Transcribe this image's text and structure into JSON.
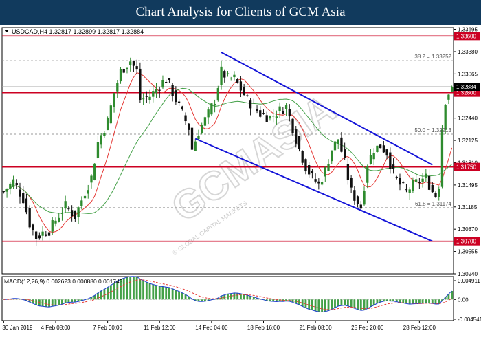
{
  "banner": {
    "title": "Chart Analysis for Clients of GCM Asia"
  },
  "chart_data": {
    "type": "candlestick",
    "symbol_header": "USDCAD,H4  1.32817 1.32899 1.32817 1.32884",
    "watermark": {
      "big": "GCMASIA",
      "small": "© GLOBAL CAPITAL MARKETS"
    },
    "price_axis": {
      "range": [
        1.3024,
        1.3372
      ],
      "ticks": [
        {
          "v": 1.33695,
          "label": "1.33695"
        },
        {
          "v": 1.3338,
          "label": "1.33380"
        },
        {
          "v": 1.33065,
          "label": "1.33065"
        },
        {
          "v": 1.3244,
          "label": "1.32440"
        },
        {
          "v": 1.32125,
          "label": "1.32125"
        },
        {
          "v": 1.3181,
          "label": "1.31810"
        },
        {
          "v": 1.31495,
          "label": "1.31495"
        },
        {
          "v": 1.31185,
          "label": "1.31185"
        },
        {
          "v": 1.3087,
          "label": "1.30870"
        },
        {
          "v": 1.30555,
          "label": "1.30555"
        },
        {
          "v": 1.3024,
          "label": "1.30240"
        }
      ]
    },
    "x_axis": {
      "labels": [
        "30 Jan 2019",
        "4 Feb 08:00",
        "7 Feb 00:00",
        "11 Feb 12:00",
        "14 Feb 04:00",
        "18 Feb 16:00",
        "21 Feb 08:00",
        "25 Feb 20:00",
        "28 Feb 12:00"
      ],
      "label_index": [
        0,
        16,
        32,
        48,
        64,
        80,
        96,
        112,
        128
      ],
      "bar_count": 139
    },
    "levels": [
      {
        "price": 1.336,
        "label": "1.33600",
        "color": "#cc0022"
      },
      {
        "price": 1.328,
        "label": "1.32800",
        "color": "#cc0022"
      },
      {
        "price": 1.3175,
        "label": "1.31750",
        "color": "#cc0022"
      },
      {
        "price": 1.307,
        "label": "1.30700",
        "color": "#cc0022"
      }
    ],
    "current_price": {
      "price": 1.32884,
      "label": "1.32884"
    },
    "fibonacci": [
      {
        "price": 1.33252,
        "label": "38.2 = 1.33252"
      },
      {
        "price": 1.32213,
        "label": "50.0 = 1.32213"
      },
      {
        "price": 1.31174,
        "label": "61.8 = 1.31174"
      }
    ],
    "channel_lines": [
      {
        "from": {
          "i": 67,
          "p": 1.3337
        },
        "to": {
          "i": 132,
          "p": 1.3178
        }
      },
      {
        "from": {
          "i": 59,
          "p": 1.3215
        },
        "to": {
          "i": 132,
          "p": 1.307
        }
      }
    ],
    "price_waypoints": [
      [
        0,
        1.314
      ],
      [
        3,
        1.3155
      ],
      [
        6,
        1.313
      ],
      [
        8,
        1.3095
      ],
      [
        10,
        1.3075
      ],
      [
        12,
        1.3082
      ],
      [
        14,
        1.3085
      ],
      [
        16,
        1.31
      ],
      [
        19,
        1.312
      ],
      [
        22,
        1.3105
      ],
      [
        25,
        1.314
      ],
      [
        27,
        1.316
      ],
      [
        29,
        1.321
      ],
      [
        32,
        1.324
      ],
      [
        34,
        1.328
      ],
      [
        36,
        1.331
      ],
      [
        39,
        1.3325
      ],
      [
        41,
        1.331
      ],
      [
        42,
        1.327
      ],
      [
        45,
        1.3275
      ],
      [
        48,
        1.329
      ],
      [
        50,
        1.33
      ],
      [
        52,
        1.328
      ],
      [
        55,
        1.325
      ],
      [
        57,
        1.323
      ],
      [
        58,
        1.32
      ],
      [
        60,
        1.3225
      ],
      [
        63,
        1.325
      ],
      [
        65,
        1.327
      ],
      [
        67,
        1.331
      ],
      [
        69,
        1.33
      ],
      [
        71,
        1.33
      ],
      [
        73,
        1.3285
      ],
      [
        75,
        1.327
      ],
      [
        77,
        1.326
      ],
      [
        79,
        1.325
      ],
      [
        82,
        1.3245
      ],
      [
        85,
        1.3255
      ],
      [
        87,
        1.326
      ],
      [
        89,
        1.323
      ],
      [
        91,
        1.32
      ],
      [
        93,
        1.3175
      ],
      [
        95,
        1.316
      ],
      [
        97,
        1.315
      ],
      [
        99,
        1.317
      ],
      [
        101,
        1.32
      ],
      [
        103,
        1.3215
      ],
      [
        105,
        1.318
      ],
      [
        107,
        1.314
      ],
      [
        109,
        1.3125
      ],
      [
        110,
        1.3118
      ],
      [
        112,
        1.318
      ],
      [
        114,
        1.32
      ],
      [
        116,
        1.3205
      ],
      [
        118,
        1.3195
      ],
      [
        120,
        1.3165
      ],
      [
        122,
        1.315
      ],
      [
        124,
        1.314
      ],
      [
        126,
        1.315
      ],
      [
        128,
        1.3155
      ],
      [
        130,
        1.316
      ],
      [
        132,
        1.314
      ],
      [
        133,
        1.3135
      ],
      [
        134,
        1.315
      ],
      [
        135,
        1.323
      ],
      [
        136,
        1.327
      ],
      [
        137,
        1.328
      ],
      [
        138,
        1.3288
      ]
    ],
    "indicators": {
      "ma_fast": {
        "name": "MA fast",
        "color": "#e53935"
      },
      "ma_slow": {
        "name": "MA slow",
        "color": "#43a047"
      }
    },
    "macd": {
      "label": "MACD(12,26,9) 0.002623 0.000880 0.001743",
      "range": [
        -0.0048,
        0.0052
      ],
      "ticks": [
        {
          "v": 0.004911,
          "label": "0.004911"
        },
        {
          "v": 0.0,
          "label": "0.00"
        },
        {
          "v": -0.004541,
          "label": "-0.004541"
        }
      ],
      "hist_color": "#43a047",
      "macd_color": "#1e40d0",
      "signal_color": "#e53935"
    },
    "colors": {
      "bull": "#2e8b2e",
      "bear": "#111111",
      "channel": "#1414d8",
      "grid": "#999999"
    }
  }
}
